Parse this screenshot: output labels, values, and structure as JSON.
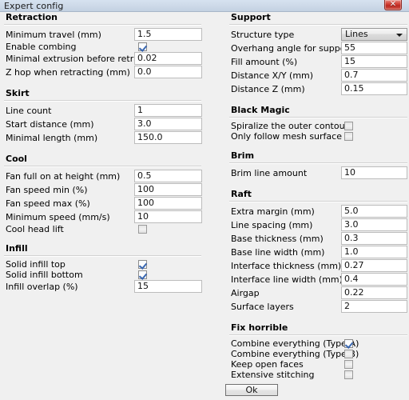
{
  "window": {
    "title": "Expert config",
    "close_label": "✕"
  },
  "footer": {
    "ok_label": "Ok"
  },
  "left_column": [
    {
      "title": "Retraction",
      "rows": [
        {
          "label": "Minimum travel (mm)",
          "type": "text",
          "value": "1.5"
        },
        {
          "label": "Enable combing",
          "type": "checkbox",
          "checked": true
        },
        {
          "label": "Minimal extrusion before retracting (mm)",
          "type": "text",
          "value": "0.02"
        },
        {
          "label": "Z hop when retracting (mm)",
          "type": "text",
          "value": "0.0"
        }
      ]
    },
    {
      "title": "Skirt",
      "rows": [
        {
          "label": "Line count",
          "type": "text",
          "value": "1"
        },
        {
          "label": "Start distance (mm)",
          "type": "text",
          "value": "3.0"
        },
        {
          "label": "Minimal length (mm)",
          "type": "text",
          "value": "150.0"
        }
      ]
    },
    {
      "title": "Cool",
      "rows": [
        {
          "label": "Fan full on at height (mm)",
          "type": "text",
          "value": "0.5"
        },
        {
          "label": "Fan speed min (%)",
          "type": "text",
          "value": "100"
        },
        {
          "label": "Fan speed max (%)",
          "type": "text",
          "value": "100"
        },
        {
          "label": "Minimum speed (mm/s)",
          "type": "text",
          "value": "10"
        },
        {
          "label": "Cool head lift",
          "type": "checkbox",
          "checked": false
        }
      ]
    },
    {
      "title": "Infill",
      "rows": [
        {
          "label": "Solid infill top",
          "type": "checkbox",
          "checked": true
        },
        {
          "label": "Solid infill bottom",
          "type": "checkbox",
          "checked": true
        },
        {
          "label": "Infill overlap (%)",
          "type": "text",
          "value": "15"
        }
      ]
    }
  ],
  "right_column": [
    {
      "title": "Support",
      "rows": [
        {
          "label": "Structure type",
          "type": "dropdown",
          "value": "Lines"
        },
        {
          "label": "Overhang angle for support (deg)",
          "type": "text",
          "value": "55"
        },
        {
          "label": "Fill amount (%)",
          "type": "text",
          "value": "15"
        },
        {
          "label": "Distance X/Y (mm)",
          "type": "text",
          "value": "0.7"
        },
        {
          "label": "Distance Z (mm)",
          "type": "text",
          "value": "0.15"
        }
      ]
    },
    {
      "title": "Black Magic",
      "rows": [
        {
          "label": "Spiralize the outer contour",
          "type": "checkbox",
          "checked": false
        },
        {
          "label": "Only follow mesh surface",
          "type": "checkbox",
          "checked": false
        }
      ]
    },
    {
      "title": "Brim",
      "rows": [
        {
          "label": "Brim line amount",
          "type": "text",
          "value": "10"
        }
      ]
    },
    {
      "title": "Raft",
      "rows": [
        {
          "label": "Extra margin (mm)",
          "type": "text",
          "value": "5.0"
        },
        {
          "label": "Line spacing (mm)",
          "type": "text",
          "value": "3.0"
        },
        {
          "label": "Base thickness (mm)",
          "type": "text",
          "value": "0.3"
        },
        {
          "label": "Base line width (mm)",
          "type": "text",
          "value": "1.0"
        },
        {
          "label": "Interface thickness (mm)",
          "type": "text",
          "value": "0.27"
        },
        {
          "label": "Interface line width (mm)",
          "type": "text",
          "value": "0.4"
        },
        {
          "label": "Airgap",
          "type": "text",
          "value": "0.22"
        },
        {
          "label": "Surface layers",
          "type": "text",
          "value": "2"
        }
      ]
    },
    {
      "title": "Fix horrible",
      "rows": [
        {
          "label": "Combine everything (Type-A)",
          "type": "checkbox",
          "checked": true
        },
        {
          "label": "Combine everything (Type-B)",
          "type": "checkbox",
          "checked": false
        },
        {
          "label": "Keep open faces",
          "type": "checkbox",
          "checked": false
        },
        {
          "label": "Extensive stitching",
          "type": "checkbox",
          "checked": false
        }
      ]
    }
  ]
}
